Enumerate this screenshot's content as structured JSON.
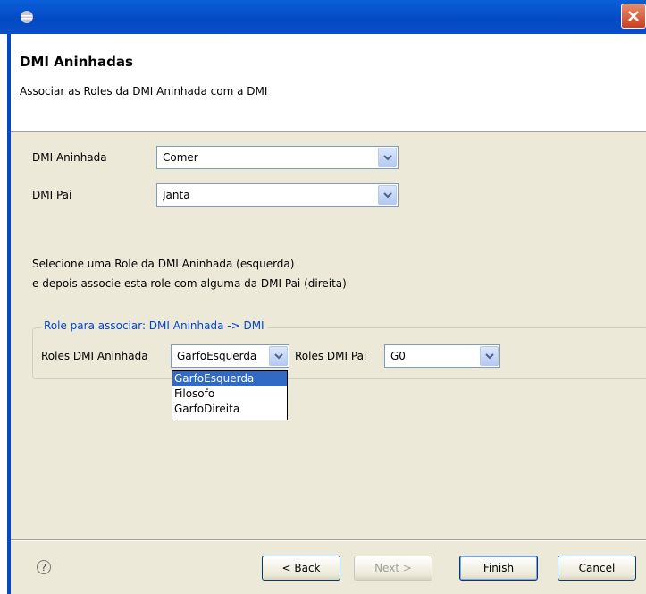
{
  "page": {
    "title": "DMI Aninhadas",
    "description": "Associar as Roles da DMI Aninhada com a DMI"
  },
  "form": {
    "dmi_aninhada_label": "DMI Aninhada",
    "dmi_aninhada_value": "Comer",
    "dmi_pai_label": "DMI Pai",
    "dmi_pai_value": "Janta"
  },
  "instructions": {
    "line1": "Selecione uma Role da DMI Aninhada (esquerda)",
    "line2": "e depois associe esta role com alguma da DMI Pai (direita)"
  },
  "group": {
    "title": "Role para associar: DMI Aninhada -> DMI",
    "roles_aninhada_label": "Roles DMI Aninhada",
    "roles_aninhada_value": "GarfoEsquerda",
    "roles_pai_label": "Roles DMI Pai",
    "roles_pai_value": "G0"
  },
  "dropdown": {
    "items": [
      "GarfoEsquerda",
      "Filosofo",
      "GarfoDireita"
    ],
    "selected_index": 0
  },
  "buttons": {
    "help": "?",
    "back": "< Back",
    "next": "Next >",
    "finish": "Finish",
    "cancel": "Cancel"
  },
  "icons": {
    "title": "eclipse-icon",
    "close": "close-icon",
    "help": "help-icon",
    "dropdown_arrow": "chevron-down-icon"
  },
  "colors": {
    "titlebar": "#0449c4",
    "group_title": "#0046d5",
    "selection": "#316ac5"
  }
}
